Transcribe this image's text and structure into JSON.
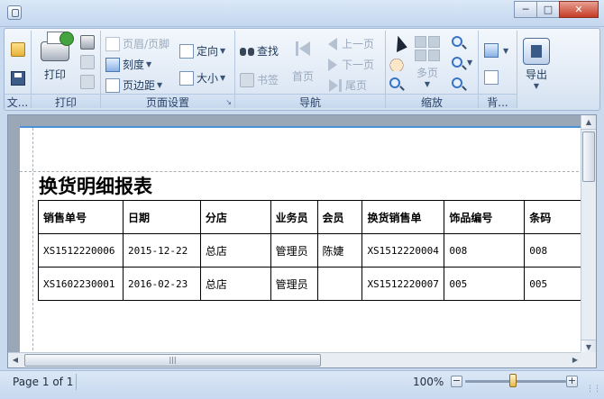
{
  "ribbon": {
    "file": {
      "label": "文..."
    },
    "print": {
      "print_label": "打印",
      "group_label": "打印"
    },
    "page_setup": {
      "header_footer": "页眉/页脚",
      "orientation": "定向",
      "scale": "刻度",
      "margins": "页边距",
      "size": "大小",
      "group_label": "页面设置"
    },
    "navigation": {
      "find": "查找",
      "bookmark": "书签",
      "first_page": "首页",
      "prev_page": "上一页",
      "next_page": "下一页",
      "last_page": "尾页",
      "group_label": "导航"
    },
    "zoom": {
      "multi_page": "多页",
      "group_label": "缩放"
    },
    "background": {
      "group_label": "背..."
    },
    "export": {
      "export_label": "导出"
    }
  },
  "report": {
    "title": "换货明细报表",
    "columns": [
      "销售单号",
      "日期",
      "分店",
      "业务员",
      "会员",
      "换货销售单",
      "饰品编号",
      "条码"
    ],
    "rows": [
      [
        "XS1512220006",
        "2015-12-22",
        "总店",
        "管理员",
        "陈婕",
        "XS1512220004",
        "008",
        "008"
      ],
      [
        "XS1602230001",
        "2016-02-23",
        "总店",
        "管理员",
        "",
        "XS1512220007",
        "005",
        "005"
      ]
    ]
  },
  "status": {
    "page_info": "Page 1 of 1",
    "zoom_level": "100%",
    "zoom_fraction": 0.47
  }
}
